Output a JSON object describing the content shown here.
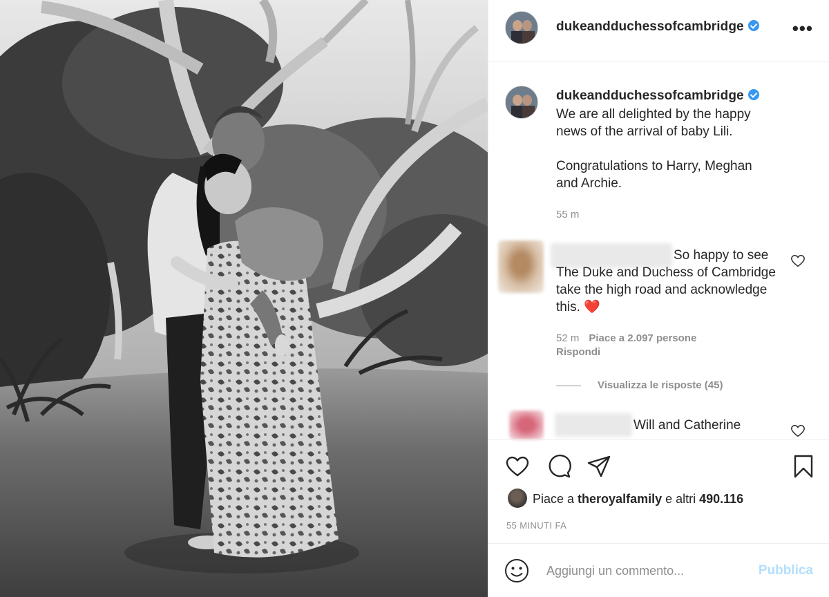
{
  "post": {
    "username": "dukeandduchessofcambridge",
    "more_label": "•••",
    "image_alt": "Black and white photo of a couple embracing and holding a baby under trees"
  },
  "caption": {
    "username": "dukeandduchessofcambridge",
    "text": "We are all delighted by the happy\nnews of the arrival of baby Lili.\n\nCongratulations to Harry, Meghan\nand Archie.",
    "time": "55 m"
  },
  "comments": [
    {
      "text": "So happy to see The Duke and Duchess of Cambridge take the high road and acknowledge this. ❤️",
      "time": "52 m",
      "likes": "Piace a 2.097 persone",
      "reply": "Rispondi",
      "view_replies": "Visualizza le risposte (45)"
    },
    {
      "text": "Will and Catherine"
    }
  ],
  "likes": {
    "prefix": "Piace a ",
    "user": "theroyalfamily",
    "middle": " e altri ",
    "count": "490.116"
  },
  "date": "55 MINUTI FA",
  "add_comment": {
    "placeholder": "Aggiungi un commento...",
    "publish": "Pubblica"
  },
  "icons": [
    "heart-icon",
    "comment-icon",
    "share-icon",
    "bookmark-icon",
    "emoji-icon",
    "verified-icon",
    "more-icon"
  ],
  "colors": {
    "verified": "#3897f0",
    "publish_disabled": "#b2dffc",
    "meta_gray": "#8e8e8e",
    "heart_red": "#e0162b"
  }
}
